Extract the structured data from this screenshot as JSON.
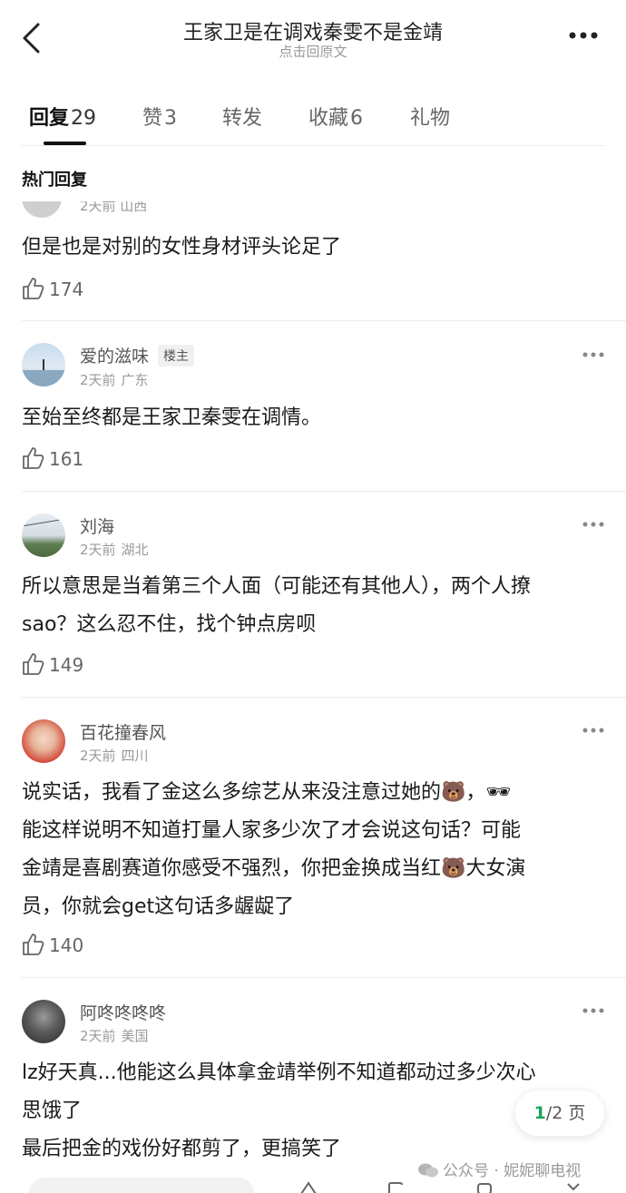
{
  "header": {
    "title": "王家卫是在调戏秦雯不是金靖",
    "subtitle": "点击回原文",
    "back_icon": "chevron-left-icon",
    "more_icon": "more-dots-icon"
  },
  "tabs": [
    {
      "label": "回复",
      "count": "29",
      "active": true
    },
    {
      "label": "赞",
      "count": "3",
      "active": false
    },
    {
      "label": "转发",
      "count": "",
      "active": false
    },
    {
      "label": "收藏",
      "count": "6",
      "active": false
    },
    {
      "label": "礼物",
      "count": "",
      "active": false
    }
  ],
  "section_title": "热门回复",
  "partial_comment": {
    "meta": "2天前 山西",
    "text": "但是也是对别的女性身材评头论足了",
    "likes": "174"
  },
  "comments": [
    {
      "name": "爱的滋味",
      "badge": "楼主",
      "time": "2天前",
      "location": "广东",
      "lines": [
        "至始至终都是王家卫秦雯在调情。"
      ],
      "likes": "161"
    },
    {
      "name": "刘海",
      "badge": "",
      "time": "2天前",
      "location": "湖北",
      "lines": [
        "所以意思是当着第三个人面（可能还有其他人），两个人撩",
        "sao？这么忍不住，找个钟点房呗"
      ],
      "likes": "149"
    },
    {
      "name": "百花撞春风",
      "badge": "",
      "time": "2天前",
      "location": "四川",
      "lines": [
        "说实话，我看了金这么多综艺从来没注意过她的🐻，🕶",
        "能这样说明不知道打量人家多少次了才会说这句话？可能",
        "金靖是喜剧赛道你感受不强烈，你把金换成当红🐻大女演",
        "员，你就会get这句话多龌龊了"
      ],
      "likes": "140"
    },
    {
      "name": "阿咚咚咚咚",
      "badge": "",
      "time": "2天前",
      "location": "美国",
      "lines": [
        "lz好天真...他能这么具体拿金靖举例不知道都动过多少次心",
        "思饿了",
        "最后把金的戏份好都剪了，更搞笑了"
      ],
      "likes": ""
    }
  ],
  "pager": {
    "current": "1",
    "total": "/2 页"
  },
  "watermark": "公众号 · 妮妮聊电视",
  "icons": {
    "like": "thumbs-up-icon",
    "comment_more": "more-dots-icon"
  },
  "colors": {
    "accent_green": "#1aa85a",
    "text": "#1a1a1a",
    "muted": "#9a9a9a"
  }
}
